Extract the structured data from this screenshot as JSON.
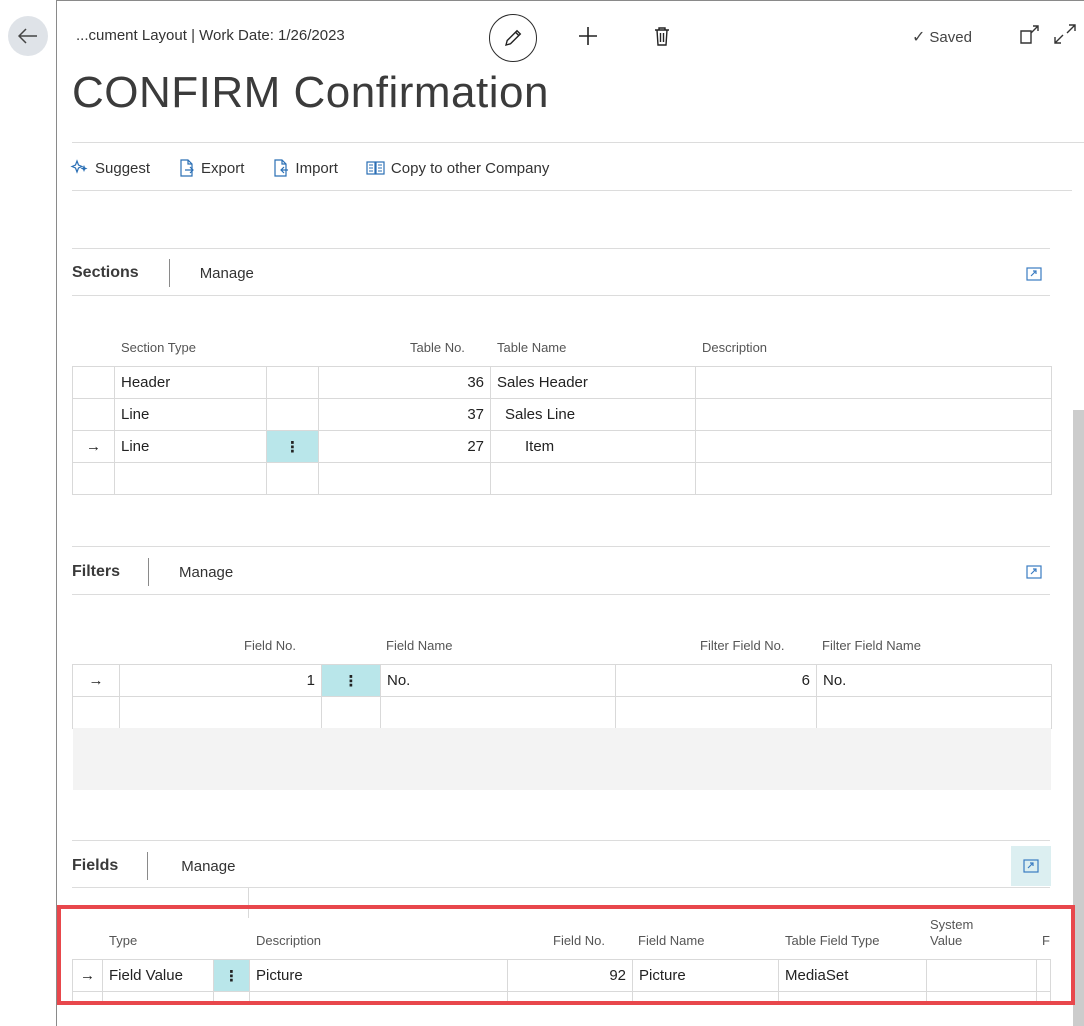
{
  "header": {
    "breadcrumb": "...cument Layout | Work Date: 1/26/2023",
    "saved": "Saved",
    "title": "CONFIRM Confirmation"
  },
  "actions": {
    "suggest": "Suggest",
    "export": "Export",
    "import": "Import",
    "copy": "Copy to other Company"
  },
  "sections": {
    "title": "Sections",
    "manage": "Manage",
    "columns": {
      "section_type": "Section Type",
      "table_no": "Table No.",
      "table_name": "Table Name",
      "description": "Description"
    },
    "rows": [
      {
        "section_type": "Header",
        "table_no": "36",
        "table_name": "Sales Header",
        "description": ""
      },
      {
        "section_type": "Line",
        "table_no": "37",
        "table_name": "Sales Line",
        "description": ""
      },
      {
        "section_type": "Line",
        "table_no": "27",
        "table_name": "Item",
        "description": ""
      }
    ]
  },
  "filters": {
    "title": "Filters",
    "manage": "Manage",
    "columns": {
      "field_no": "Field No.",
      "field_name": "Field Name",
      "filter_field_no": "Filter Field No.",
      "filter_field_name": "Filter Field Name"
    },
    "rows": [
      {
        "field_no": "1",
        "field_name": "No.",
        "filter_field_no": "6",
        "filter_field_name": "No."
      }
    ]
  },
  "fields": {
    "title": "Fields",
    "manage": "Manage",
    "columns": {
      "type": "Type",
      "description": "Description",
      "field_no": "Field No.",
      "field_name": "Field Name",
      "table_field_type": "Table Field Type",
      "system_value_1": "System",
      "system_value_2": "Value",
      "trunc": "Fo"
    },
    "rows": [
      {
        "type": "Field Value",
        "description": "Picture",
        "field_no": "92",
        "field_name": "Picture",
        "table_field_type": "MediaSet"
      }
    ]
  },
  "glyphs": {
    "arrow": "→",
    "dots": "⋮",
    "check": "✓"
  },
  "colors": {
    "selected_cell": "#b9e6ea",
    "highlight_border": "#e8474c"
  }
}
